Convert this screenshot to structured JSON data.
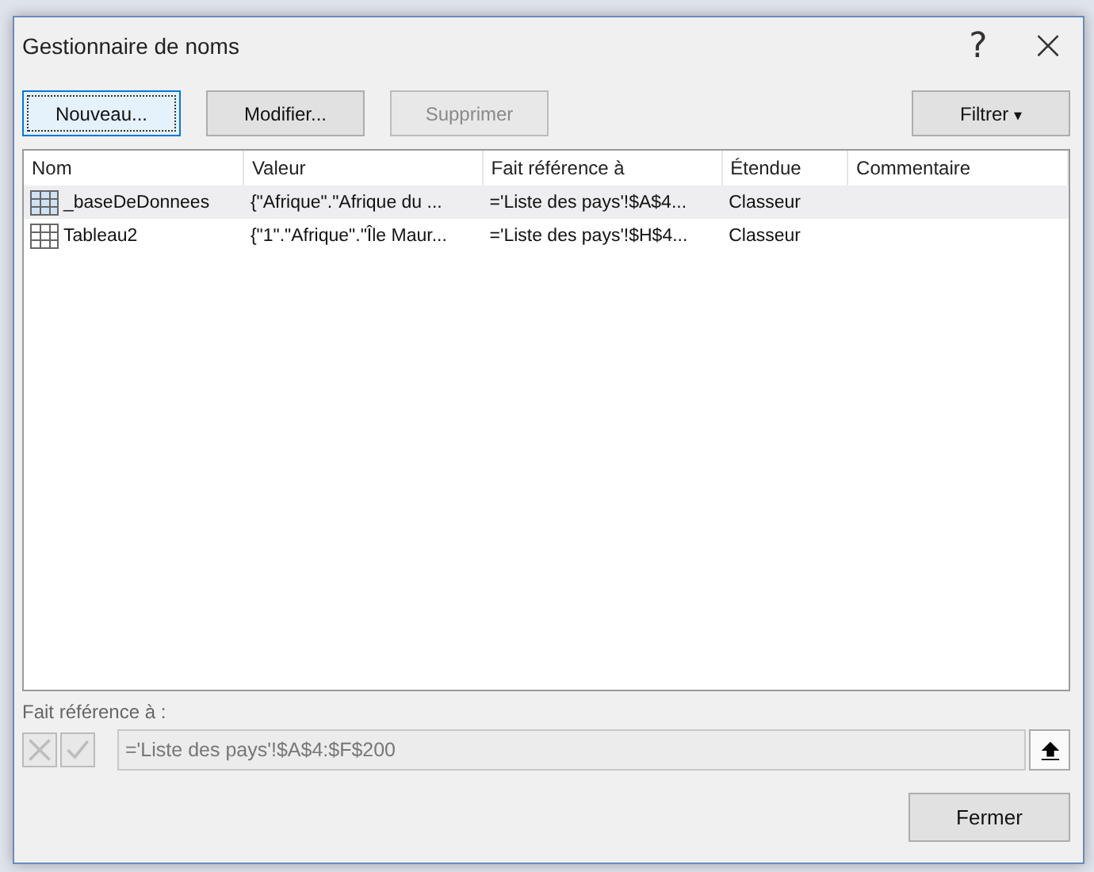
{
  "window": {
    "title": "Gestionnaire de noms",
    "help": "?",
    "close": "×"
  },
  "toolbar": {
    "buttons": [
      {
        "label": "Nouveau...",
        "focused": true,
        "disabled": false
      },
      {
        "label": "Modifier...",
        "focused": false,
        "disabled": false
      },
      {
        "label": "Supprimer",
        "focused": false,
        "disabled": true
      }
    ],
    "filter": {
      "label": "Filtrer",
      "caret": "▾"
    }
  },
  "table": {
    "columns": [
      "Nom",
      "Valeur",
      "Fait référence à",
      "Étendue",
      "Commentaire"
    ],
    "rows": [
      {
        "selected": true,
        "cells": [
          "_baseDeDonnees",
          "{\"Afrique\".\"Afrique du ...",
          "='Liste des pays'!$A$4...",
          "Classeur",
          ""
        ]
      },
      {
        "selected": false,
        "cells": [
          "Tableau2",
          "{\"1\".\"Afrique\".\"Île Maur...",
          "='Liste des pays'!$H$4...",
          "Classeur",
          ""
        ]
      }
    ]
  },
  "reference": {
    "label": "Fait référence à :",
    "value": "='Liste des pays'!$A$4:$F$200",
    "cancel_disabled": true,
    "confirm_disabled": true
  },
  "footer": {
    "close_button": "Fermer"
  }
}
